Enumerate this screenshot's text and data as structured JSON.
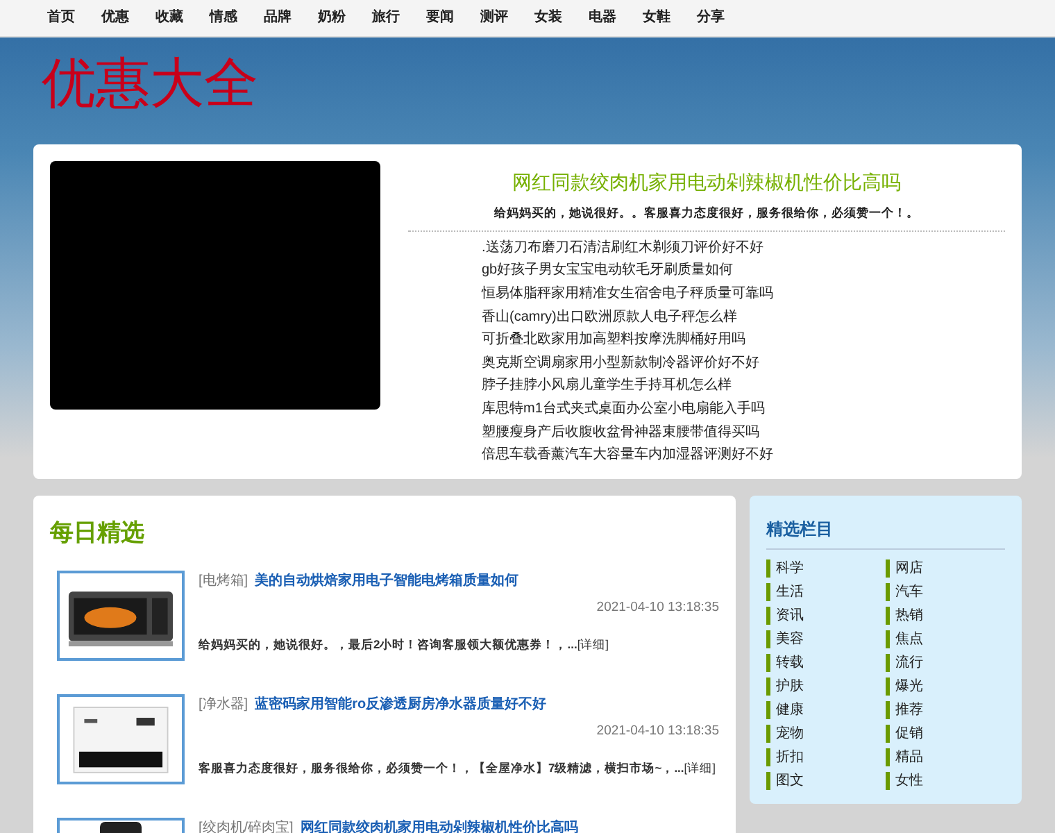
{
  "nav": {
    "items": [
      {
        "label": "首页"
      },
      {
        "label": "优惠"
      },
      {
        "label": "收藏"
      },
      {
        "label": "情感"
      },
      {
        "label": "品牌"
      },
      {
        "label": "奶粉"
      },
      {
        "label": "旅行"
      },
      {
        "label": "要闻"
      },
      {
        "label": "测评"
      },
      {
        "label": "女装"
      },
      {
        "label": "电器"
      },
      {
        "label": "女鞋"
      },
      {
        "label": "分享"
      }
    ]
  },
  "site_title": "优惠大全",
  "featured": {
    "title": "网红同款绞肉机家用电动剁辣椒机性价比高吗",
    "summary": "给妈妈买的，她说很好。。客服喜力态度很好，服务很给你，必须赞一个！。",
    "links": [
      ".送荡刀布磨刀石清洁刷红木剃须刀评价好不好",
      "gb好孩子男女宝宝电动软毛牙刷质量如何",
      "恒易体脂秤家用精准女生宿舍电子秤质量可靠吗",
      "香山(camry)出口欧洲原款人电子秤怎么样",
      "可折叠北欧家用加高塑料按摩洗脚桶好用吗",
      "奥克斯空调扇家用小型新款制冷器评价好不好",
      "脖子挂脖小风扇儿童学生手持耳机怎么样",
      "库思特m1台式夹式桌面办公室小电扇能入手吗",
      "塑腰瘦身产后收腹收盆骨神器束腰带值得买吗",
      "倍思车载香薰汽车大容量车内加湿器评测好不好"
    ]
  },
  "daily": {
    "heading": "每日精选",
    "articles": [
      {
        "category": "[电烤箱]",
        "title": "美的自动烘焙家用电子智能电烤箱质量如何",
        "time": "2021-04-10 13:18:35",
        "excerpt": "给妈妈买的，她说很好。，最后2小时！咨询客服领大额优惠券！，...",
        "more": "[详细]",
        "kind": "oven"
      },
      {
        "category": "[净水器]",
        "title": "蓝密码家用智能ro反渗透厨房净水器质量好不好",
        "time": "2021-04-10 13:18:35",
        "excerpt": "客服喜力态度很好，服务很给你，必须赞一个！，【全屋净水】7级精滤，横扫市场~，...",
        "more": "[详细]",
        "kind": "purifier"
      },
      {
        "category": "[绞肉机/碎肉宝]",
        "title": "网红同款绞肉机家用电动剁辣椒机性价比高吗",
        "kind": "grinder"
      }
    ]
  },
  "sidebar": {
    "heading": "精选栏目",
    "items": [
      "科学",
      "网店",
      "生活",
      "汽车",
      "资讯",
      "热销",
      "美容",
      "焦点",
      "转载",
      "流行",
      "护肤",
      "爆光",
      "健康",
      "推荐",
      "宠物",
      "促销",
      "折扣",
      "精品",
      "图文",
      "女性"
    ]
  }
}
